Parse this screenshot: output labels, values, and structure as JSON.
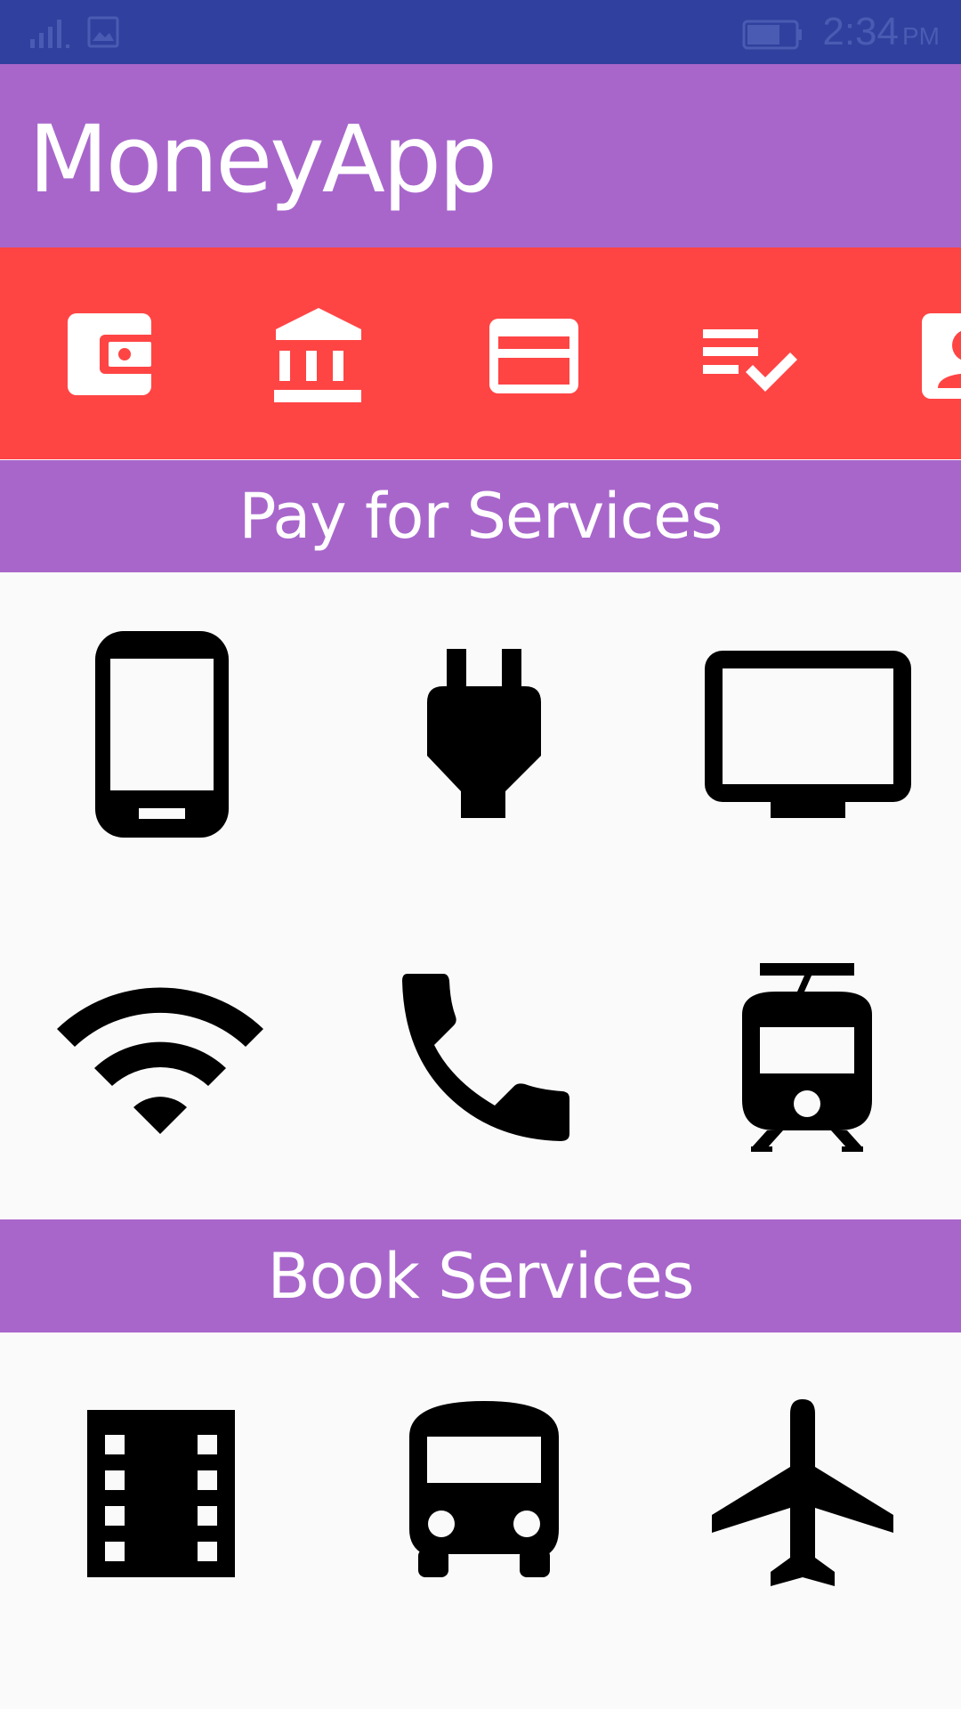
{
  "status_bar": {
    "time": "2:34",
    "ampm": "PM",
    "icons": [
      "signal-icon",
      "image-notification-icon",
      "battery-icon"
    ]
  },
  "app_bar": {
    "title": "MoneyApp",
    "color": "#a866cb"
  },
  "top_strip": {
    "color": "#ff4444",
    "icons": [
      "wallet-icon",
      "bank-icon",
      "credit-card-icon",
      "checklist-icon",
      "contact-icon"
    ]
  },
  "sections": [
    {
      "title": "Pay for Services",
      "icons": [
        "mobile-phone-icon",
        "power-plug-icon",
        "tv-icon",
        "wifi-icon",
        "phone-icon",
        "tram-icon"
      ]
    },
    {
      "title": "Book Services",
      "icons": [
        "movie-film-icon",
        "bus-icon",
        "airplane-icon"
      ]
    }
  ],
  "colors": {
    "status_bar": "#30409e",
    "accent_purple": "#a866cb",
    "accent_red": "#ff4444",
    "background": "#fafafa"
  }
}
